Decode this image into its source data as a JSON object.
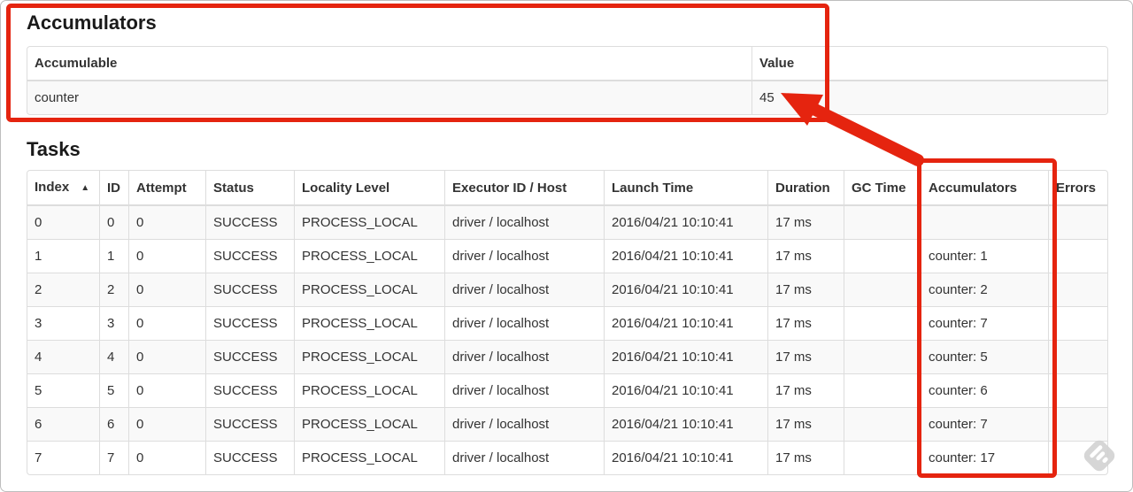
{
  "accumulators_section": {
    "title": "Accumulators",
    "table": {
      "headers": [
        "Accumulable",
        "Value"
      ],
      "rows": [
        [
          "counter",
          "45"
        ]
      ]
    }
  },
  "tasks_section": {
    "title": "Tasks",
    "table": {
      "headers": [
        "Index",
        "ID",
        "Attempt",
        "Status",
        "Locality Level",
        "Executor ID / Host",
        "Launch Time",
        "Duration",
        "GC Time",
        "Accumulators",
        "Errors"
      ],
      "sorted_column": "Index",
      "sort_icon": "▲",
      "rows": [
        [
          "0",
          "0",
          "0",
          "SUCCESS",
          "PROCESS_LOCAL",
          "driver / localhost",
          "2016/04/21 10:10:41",
          "17 ms",
          "",
          "",
          ""
        ],
        [
          "1",
          "1",
          "0",
          "SUCCESS",
          "PROCESS_LOCAL",
          "driver / localhost",
          "2016/04/21 10:10:41",
          "17 ms",
          "",
          "counter: 1",
          ""
        ],
        [
          "2",
          "2",
          "0",
          "SUCCESS",
          "PROCESS_LOCAL",
          "driver / localhost",
          "2016/04/21 10:10:41",
          "17 ms",
          "",
          "counter: 2",
          ""
        ],
        [
          "3",
          "3",
          "0",
          "SUCCESS",
          "PROCESS_LOCAL",
          "driver / localhost",
          "2016/04/21 10:10:41",
          "17 ms",
          "",
          "counter: 7",
          ""
        ],
        [
          "4",
          "4",
          "0",
          "SUCCESS",
          "PROCESS_LOCAL",
          "driver / localhost",
          "2016/04/21 10:10:41",
          "17 ms",
          "",
          "counter: 5",
          ""
        ],
        [
          "5",
          "5",
          "0",
          "SUCCESS",
          "PROCESS_LOCAL",
          "driver / localhost",
          "2016/04/21 10:10:41",
          "17 ms",
          "",
          "counter: 6",
          ""
        ],
        [
          "6",
          "6",
          "0",
          "SUCCESS",
          "PROCESS_LOCAL",
          "driver / localhost",
          "2016/04/21 10:10:41",
          "17 ms",
          "",
          "counter: 7",
          ""
        ],
        [
          "7",
          "7",
          "0",
          "SUCCESS",
          "PROCESS_LOCAL",
          "driver / localhost",
          "2016/04/21 10:10:41",
          "17 ms",
          "",
          "counter: 17",
          ""
        ]
      ]
    }
  },
  "annotations": {
    "color": "#e5240f",
    "highlighted_regions": [
      "accumulators-summary-table",
      "tasks-accumulators-column"
    ],
    "arrow_points_to": "45"
  },
  "icons": {
    "sort_ascending": "▲",
    "watermark": "feedly-logo"
  }
}
